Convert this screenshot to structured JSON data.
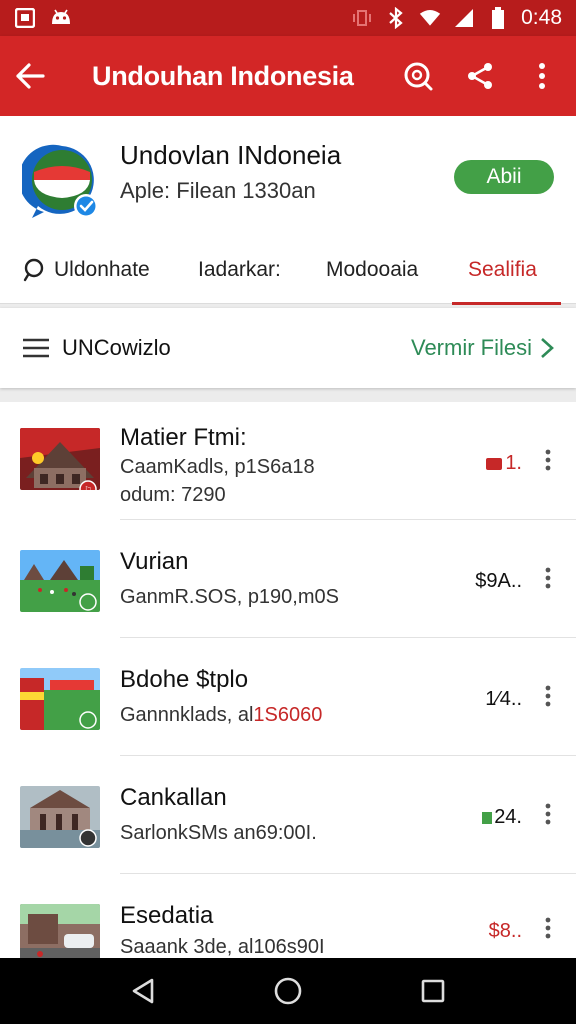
{
  "status_bar": {
    "time": "0:48",
    "icons": [
      "photo-icon",
      "android-icon",
      "vibrate-icon",
      "bluetooth-icon",
      "wifi-icon",
      "signal-icon",
      "battery-icon"
    ]
  },
  "app_bar": {
    "title": "Undouhan Indonesia",
    "background": "#d32626"
  },
  "header": {
    "app_name": "Undovlan INdoneia",
    "subtitle": "Aple: Filean 1330an",
    "open_button": "Abii",
    "accent": "#43a047"
  },
  "tabs": [
    {
      "label": "Uldonhate",
      "active": false
    },
    {
      "label": "Iadarkar:",
      "active": false
    },
    {
      "label": "Modooaia",
      "active": false
    },
    {
      "label": "Sealifia",
      "active": true
    }
  ],
  "section": {
    "title": "UNCowizlo",
    "view_all": "Vermir Filesi"
  },
  "items": [
    {
      "title": "Matier Ftmi:",
      "meta": "CaamKadls, p1S6a18",
      "meta2": "odum: 7290",
      "price": "1.",
      "price_color": "#c62828"
    },
    {
      "title": "Vurian",
      "meta": "GanmR.SOS, p190,m0S",
      "meta2": "",
      "price": "$9A..",
      "price_color": "#333333"
    },
    {
      "title": "Bdohe $tplo",
      "meta": "Gannnklads, al",
      "meta_red": "1S6060",
      "meta2": "",
      "price": "1⁄4..",
      "price_color": "#333333"
    },
    {
      "title": "Cankallan",
      "meta": "SarlonkSMs an69:00I.",
      "meta2": "",
      "price": "24.",
      "price_color": "#333333"
    },
    {
      "title": "Esedatia",
      "meta": "Saaank 3de, al106s90I",
      "meta2": "",
      "price": "$8..",
      "price_color": "#c62828"
    }
  ]
}
